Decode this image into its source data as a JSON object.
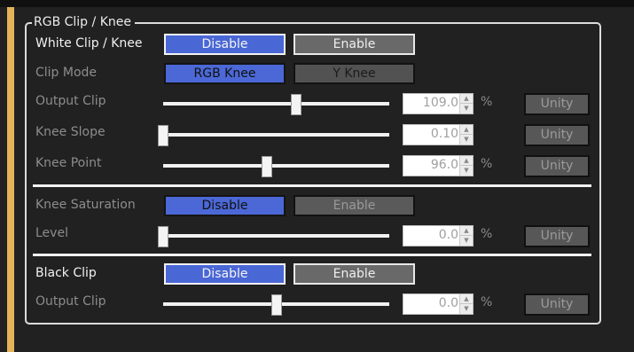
{
  "group": {
    "legend": "RGB Clip / Knee"
  },
  "white_clip": {
    "label": "White Clip / Knee",
    "disable": "Disable",
    "enable": "Enable"
  },
  "clip_mode": {
    "label": "Clip Mode",
    "rgb_knee": "RGB Knee",
    "y_knee": "Y Knee"
  },
  "output_clip": {
    "label": "Output Clip",
    "value": "109.0",
    "unit": "%",
    "unity": "Unity",
    "slider_level": 0.59
  },
  "knee_slope": {
    "label": "Knee Slope",
    "value": "0.10",
    "unity": "Unity",
    "slider_level": 0.0
  },
  "knee_point": {
    "label": "Knee Point",
    "value": "96.0",
    "unit": "%",
    "unity": "Unity",
    "slider_level": 0.46
  },
  "knee_saturation": {
    "label": "Knee Saturation",
    "disable": "Disable",
    "enable": "Enable"
  },
  "level": {
    "label": "Level",
    "value": "0.0",
    "unit": "%",
    "unity": "Unity",
    "slider_level": 0.0
  },
  "black_clip": {
    "label": "Black Clip",
    "disable": "Disable",
    "enable": "Enable"
  },
  "black_output_clip": {
    "label": "Output Clip",
    "value": "0.0",
    "unit": "%",
    "unity": "Unity",
    "slider_level": 0.5
  }
}
